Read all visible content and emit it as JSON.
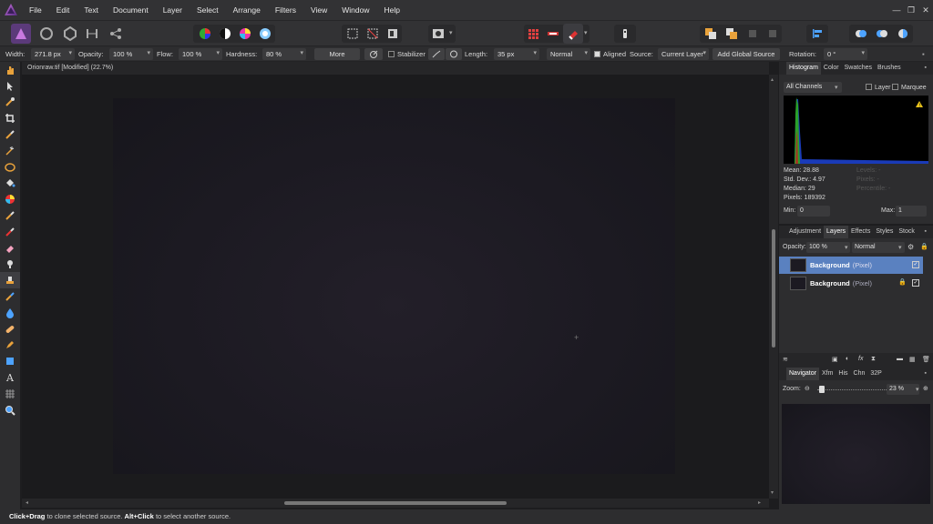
{
  "menu": [
    "File",
    "Edit",
    "Text",
    "Document",
    "Layer",
    "Select",
    "Arrange",
    "Filters",
    "View",
    "Window",
    "Help"
  ],
  "window_controls": [
    "—",
    "❐",
    "✕"
  ],
  "context": {
    "width_label": "Width:",
    "width_value": "271.8 px",
    "opacity_label": "Opacity:",
    "opacity_value": "100 %",
    "flow_label": "Flow:",
    "flow_value": "100 %",
    "hardness_label": "Hardness:",
    "hardness_value": "80 %",
    "more_button": "More",
    "stabilizer_label": "Stabilizer",
    "length_label": "Length:",
    "length_value": "35 px",
    "blend_mode": "Normal",
    "aligned_label": "Aligned",
    "source_label": "Source:",
    "source_value": "Current Layer",
    "add_global_source": "Add Global Source",
    "rotation_label": "Rotation:",
    "rotation_value": "0 °"
  },
  "document": {
    "tab_title": "Orionraw.tif [Modified] (22.7%)"
  },
  "status": {
    "click_drag": "Click+Drag",
    "text1": " to clone selected source. ",
    "alt_click": "Alt+Click",
    "text2": " to select another source."
  },
  "histogram_panel": {
    "tabs": [
      "Histogram",
      "Color",
      "Swatches",
      "Brushes"
    ],
    "channel": "All Channels",
    "layer_label": "Layer",
    "marquee_label": "Marquee",
    "mean": "Mean: 28.88",
    "stddev": "Std. Dev.: 4.97",
    "median": "Median: 29",
    "pixels": "Pixels: 189392",
    "levels": "Levels: -",
    "pixels2": "Pixels: -",
    "percentile": "Percentile: -",
    "min_label": "Min:",
    "min_value": "0",
    "max_label": "Max:",
    "max_value": "1",
    "warning_color": "#e8c21c"
  },
  "layers_panel": {
    "tabs": [
      "Adjustment",
      "Layers",
      "Effects",
      "Styles",
      "Stock"
    ],
    "opacity_label": "Opacity:",
    "opacity_value": "100 %",
    "blend_mode": "Normal",
    "layers": [
      {
        "name": "Background",
        "type": "(Pixel)",
        "selected": true
      },
      {
        "name": "Background",
        "type": "(Pixel)",
        "selected": false,
        "locked": true
      }
    ],
    "accent_color": "#4a6fa5"
  },
  "navigator_panel": {
    "tabs": [
      "Navigator",
      "Xfm",
      "His",
      "Chn",
      "32P"
    ],
    "zoom_label": "Zoom:",
    "zoom_value": "23 %"
  }
}
